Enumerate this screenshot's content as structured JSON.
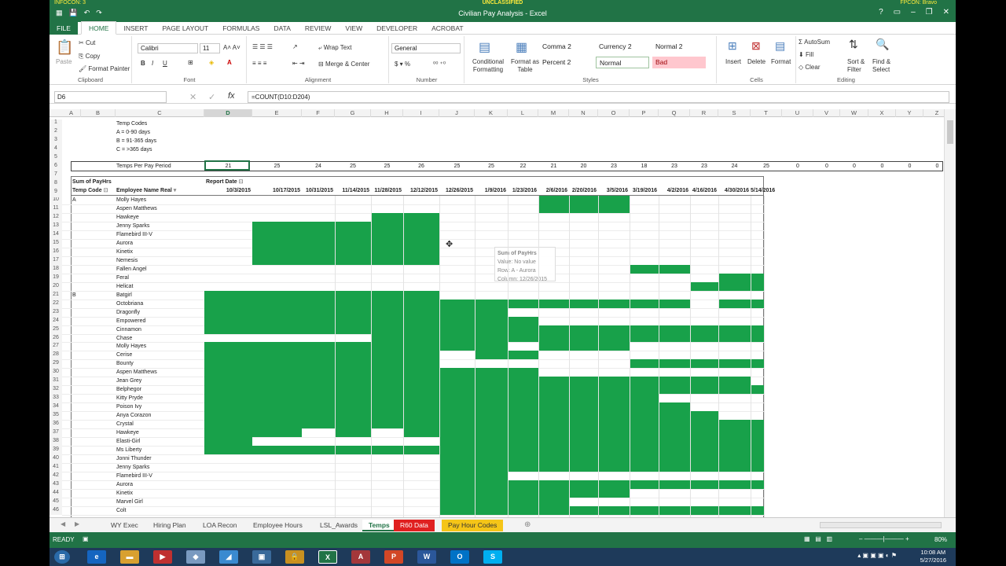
{
  "banner": {
    "left": "INFOCON: 3",
    "center": "UNCLASSIFIED",
    "right": "FPCON: Bravo"
  },
  "window": {
    "title": "Civilian Pay Analysis - Excel"
  },
  "tabs": [
    "FILE",
    "HOME",
    "INSERT",
    "PAGE LAYOUT",
    "FORMULAS",
    "DATA",
    "REVIEW",
    "VIEW",
    "DEVELOPER",
    "ACROBAT"
  ],
  "ribbon": {
    "clipboard": {
      "paste": "Paste",
      "cut": "Cut",
      "copy": "Copy",
      "format_painter": "Format Painter",
      "label": "Clipboard"
    },
    "font": {
      "name": "Calibri",
      "size": "11",
      "label": "Font"
    },
    "alignment": {
      "wrap": "Wrap Text",
      "merge": "Merge & Center",
      "label": "Alignment"
    },
    "number": {
      "format": "General",
      "label": "Number"
    },
    "styles": {
      "conditional": "Conditional Formatting",
      "format_table": "Format as Table",
      "comma": "Comma 2",
      "currency": "Currency 2",
      "normal2": "Normal 2",
      "percent": "Percent 2",
      "normal": "Normal",
      "bad": "Bad",
      "label": "Styles"
    },
    "cells": {
      "insert": "Insert",
      "delete": "Delete",
      "format": "Format",
      "label": "Cells"
    },
    "editing": {
      "autosum": "AutoSum",
      "fill": "Fill",
      "clear": "Clear",
      "sort": "Sort & Filter",
      "find": "Find & Select",
      "label": "Editing"
    }
  },
  "formula_bar": {
    "name_box": "D6",
    "formula": "=COUNT(D10:D204)"
  },
  "columns": [
    "A",
    "B",
    "C",
    "D",
    "E",
    "F",
    "G",
    "H",
    "I",
    "J",
    "K",
    "L",
    "M",
    "N",
    "O",
    "P",
    "Q",
    "R",
    "S",
    "T",
    "U",
    "V",
    "W",
    "X",
    "Y",
    "Z",
    "A"
  ],
  "legend": {
    "title": "Temp Codes",
    "a": "A = 0-90 days",
    "b": "B = 91-365 days",
    "c": "C = >365 days"
  },
  "temps_label": "Temps Per Pay Period",
  "counts": [
    "21",
    "25",
    "24",
    "25",
    "25",
    "26",
    "25",
    "25",
    "22",
    "21",
    "20",
    "23",
    "18",
    "23",
    "23",
    "24",
    "25",
    "0",
    "0",
    "0",
    "0",
    "0",
    "0",
    "0"
  ],
  "pivot": {
    "sum_label": "Sum of PayHrs",
    "report_date": "Report Date",
    "temp_code": "Temp Code",
    "emp_name": "Employee Name Real"
  },
  "dates": [
    "10/3/2015",
    "10/17/2015",
    "10/31/2015",
    "11/14/2015",
    "11/28/2015",
    "12/12/2015",
    "12/26/2015",
    "1/9/2016",
    "1/23/2016",
    "2/6/2016",
    "2/20/2016",
    "3/5/2016",
    "3/19/2016",
    "4/2/2016",
    "4/16/2016",
    "4/30/2016",
    "5/14/2016"
  ],
  "rows": [
    {
      "n": "10",
      "code": "A",
      "name": "Molly Hayes",
      "g": [
        [
          9,
          12
        ]
      ]
    },
    {
      "n": "11",
      "code": "",
      "name": "Aspen Matthews",
      "g": [
        [
          9,
          12
        ]
      ]
    },
    {
      "n": "12",
      "code": "",
      "name": "Hawkeye",
      "g": [
        [
          4,
          6
        ]
      ]
    },
    {
      "n": "13",
      "code": "",
      "name": "Jenny Sparks",
      "g": [
        [
          1,
          6
        ]
      ]
    },
    {
      "n": "14",
      "code": "",
      "name": "Flamebird III-V",
      "g": [
        [
          1,
          6
        ]
      ]
    },
    {
      "n": "15",
      "code": "",
      "name": "Aurora",
      "g": [
        [
          1,
          6
        ]
      ]
    },
    {
      "n": "16",
      "code": "",
      "name": "Kinetix",
      "g": [
        [
          1,
          6
        ]
      ]
    },
    {
      "n": "17",
      "code": "",
      "name": "Nemesis",
      "g": [
        [
          1,
          6
        ]
      ]
    },
    {
      "n": "18",
      "code": "",
      "name": "Fallen Angel",
      "g": [
        [
          12,
          14
        ]
      ]
    },
    {
      "n": "19",
      "code": "",
      "name": "Feral",
      "g": [
        [
          15,
          17
        ]
      ]
    },
    {
      "n": "20",
      "code": "",
      "name": "Helicat",
      "g": [
        [
          14,
          17
        ]
      ]
    },
    {
      "n": "21",
      "code": "B",
      "name": "Batgirl",
      "g": [
        [
          0,
          6
        ]
      ]
    },
    {
      "n": "22",
      "code": "",
      "name": "Octobriana",
      "g": [
        [
          0,
          14
        ],
        [
          15,
          17
        ]
      ]
    },
    {
      "n": "23",
      "code": "",
      "name": "Dragonfly",
      "g": [
        [
          0,
          8
        ]
      ]
    },
    {
      "n": "24",
      "code": "",
      "name": "Empowered",
      "g": [
        [
          0,
          9
        ]
      ]
    },
    {
      "n": "25",
      "code": "",
      "name": "Cinnamon",
      "g": [
        [
          0,
          17
        ]
      ]
    },
    {
      "n": "26",
      "code": "",
      "name": "Chase",
      "g": [
        [
          4,
          17
        ]
      ]
    },
    {
      "n": "27",
      "code": "",
      "name": "Molly Hayes",
      "g": [
        [
          0,
          8
        ],
        [
          9,
          12
        ]
      ]
    },
    {
      "n": "28",
      "code": "",
      "name": "Cerise",
      "g": [
        [
          0,
          6
        ],
        [
          7,
          9
        ]
      ]
    },
    {
      "n": "29",
      "code": "",
      "name": "Bounty",
      "g": [
        [
          0,
          6
        ],
        [
          12,
          17
        ]
      ]
    },
    {
      "n": "30",
      "code": "",
      "name": "Aspen Matthews",
      "g": [
        [
          0,
          9
        ]
      ]
    },
    {
      "n": "31",
      "code": "",
      "name": "Jean Grey",
      "g": [
        [
          0,
          16
        ]
      ]
    },
    {
      "n": "32",
      "code": "",
      "name": "Belphegor",
      "g": [
        [
          0,
          16
        ],
        [
          16,
          17
        ]
      ]
    },
    {
      "n": "33",
      "code": "",
      "name": "Kitty Pryde",
      "g": [
        [
          0,
          13
        ]
      ]
    },
    {
      "n": "34",
      "code": "",
      "name": "Poison Ivy",
      "g": [
        [
          0,
          14
        ]
      ]
    },
    {
      "n": "35",
      "code": "",
      "name": "Anya Corazon",
      "g": [
        [
          0,
          15
        ]
      ]
    },
    {
      "n": "36",
      "code": "",
      "name": "Crystal",
      "g": [
        [
          0,
          17
        ]
      ]
    },
    {
      "n": "37",
      "code": "",
      "name": "Hawkeye",
      "g": [
        [
          0,
          2
        ],
        [
          3,
          4
        ],
        [
          5,
          17
        ]
      ]
    },
    {
      "n": "38",
      "code": "",
      "name": "Elasti-Girl",
      "g": [
        [
          0,
          1
        ],
        [
          6,
          17
        ]
      ]
    },
    {
      "n": "39",
      "code": "",
      "name": "Ms Liberty",
      "g": [
        [
          0,
          12
        ],
        [
          12,
          17
        ]
      ]
    },
    {
      "n": "40",
      "code": "",
      "name": "Jonni Thunder",
      "g": [
        [
          6,
          17
        ]
      ]
    },
    {
      "n": "41",
      "code": "",
      "name": "Jenny Sparks",
      "g": [
        [
          6,
          17
        ]
      ]
    },
    {
      "n": "42",
      "code": "",
      "name": "Flamebird III-V",
      "g": [
        [
          6,
          8
        ]
      ]
    },
    {
      "n": "43",
      "code": "",
      "name": "Aurora",
      "g": [
        [
          6,
          17
        ]
      ]
    },
    {
      "n": "44",
      "code": "",
      "name": "Kinetix",
      "g": [
        [
          6,
          12
        ]
      ]
    },
    {
      "n": "45",
      "code": "",
      "name": "Marvel Girl",
      "g": [
        [
          6,
          10
        ]
      ]
    },
    {
      "n": "46",
      "code": "",
      "name": "Colt",
      "g": [
        [
          6,
          17
        ]
      ]
    }
  ],
  "tooltip": {
    "title": "Sum of PayHrs",
    "value": "Value: No value",
    "row": "Row: A - Aurora",
    "column": "Column: 12/26/2015"
  },
  "sheets": [
    "WY Exec",
    "Hiring Plan",
    "LOA Recon",
    "Employee Hours",
    "LSL_Awards",
    "Temps",
    "R60 Data",
    "Pay Hour Codes"
  ],
  "status": {
    "ready": "READY",
    "zoom": "80%"
  },
  "clock": {
    "time": "10:08 AM",
    "date": "5/27/2016"
  },
  "colors": {
    "excel_green": "#217346",
    "fill_green": "#18a14a"
  }
}
